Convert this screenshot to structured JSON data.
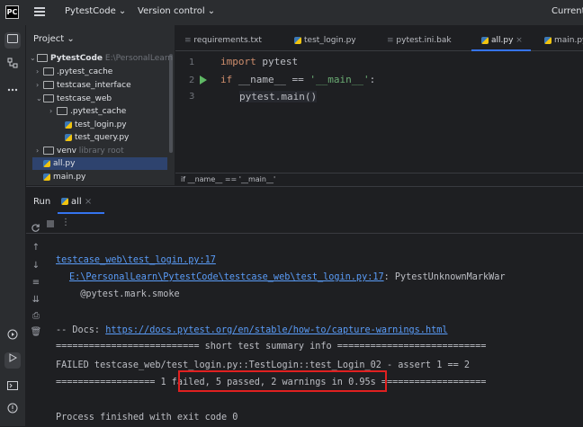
{
  "topbar": {
    "project_name": "PytestCode ⌄",
    "vcs": "Version control ⌄",
    "current": "Current"
  },
  "project_panel": {
    "header": "Project ⌄",
    "items": [
      {
        "label": "PytestCode",
        "hint": "E:\\PersonalLearn",
        "arrow": "⌄",
        "type": "folder"
      },
      {
        "label": ".pytest_cache",
        "arrow": "›",
        "type": "folder"
      },
      {
        "label": "testcase_interface",
        "arrow": "›",
        "type": "folder"
      },
      {
        "label": "testcase_web",
        "arrow": "⌄",
        "type": "folder"
      },
      {
        "label": ".pytest_cache",
        "arrow": "›",
        "type": "folder"
      },
      {
        "label": "test_login.py",
        "arrow": "",
        "type": "py"
      },
      {
        "label": "test_query.py",
        "arrow": "",
        "type": "py"
      },
      {
        "label": "venv",
        "hint": "library root",
        "arrow": "›",
        "type": "folder"
      },
      {
        "label": "all.py",
        "arrow": "",
        "type": "py"
      },
      {
        "label": "main.py",
        "arrow": "",
        "type": "py"
      }
    ]
  },
  "editor": {
    "tabs": [
      "requirements.txt",
      "test_login.py",
      "pytest.ini.bak",
      "all.py",
      "main.py"
    ],
    "close_glyph": "×",
    "line_numbers": [
      "1",
      "2",
      "3"
    ],
    "line1_kw": "import",
    "line1_rest": " pytest",
    "line2_kw": "if",
    "line2_mid": " __name__ == ",
    "line2_str": "'__main__'",
    "line2_end": ":",
    "line3": "pytest.main()",
    "breadcrumb": "if __name__ == '__main__'"
  },
  "run_panel": {
    "header": "Run",
    "tab": "all",
    "close_glyph": "×",
    "lines": {
      "l1": "testcase_web\\test_login.py:17",
      "l2_link": "E:\\PersonalLearn\\PytestCode\\testcase_web\\test_login.py:17",
      "l2_rest": ": PytestUnknownMarkWar",
      "l3": "  @pytest.mark.smoke",
      "l4_prefix": "-- Docs: ",
      "l4_link": "https://docs.pytest.org/en/stable/how-to/capture-warnings.html",
      "l5": "========================== short test summary info ===========================",
      "l6": "FAILED testcase_web/test_login.py::TestLogin::test_Login_02 - assert 1 == 2",
      "l7": "================== 1 failed, 5 passed, 2 warnings in 0.95s ===================",
      "l8": "Process finished with exit code 0"
    }
  },
  "colors": {
    "accent": "#3574f0",
    "highlight_box": "#e02020",
    "link": "#5a9cf8",
    "run_green": "#5fb865"
  }
}
